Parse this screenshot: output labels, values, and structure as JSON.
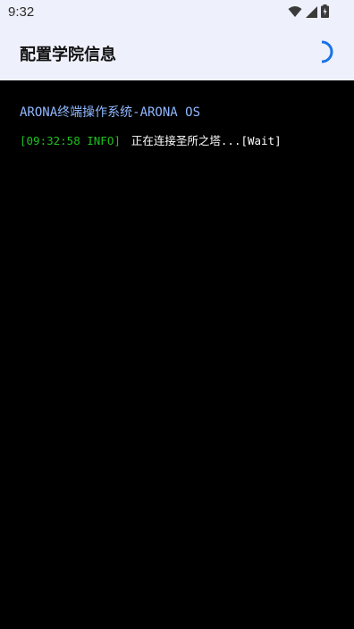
{
  "status_bar": {
    "time": "9:32",
    "icons": [
      "wifi-icon",
      "signal-icon",
      "battery-charging-icon"
    ]
  },
  "app_bar": {
    "title": "配置学院信息",
    "loading_indicator": "spinner-icon"
  },
  "terminal": {
    "header": "ARONA终端操作系统-ARONA OS",
    "log": [
      {
        "tag": "[09:32:58 INFO]",
        "message": "正在连接圣所之塔...[Wait]"
      }
    ]
  },
  "colors": {
    "app_bar_bg": "#eef0fb",
    "terminal_bg": "#000000",
    "header_text": "#90b8ff",
    "info_tag": "#1ec21e",
    "spinner": "#1a73e8"
  }
}
